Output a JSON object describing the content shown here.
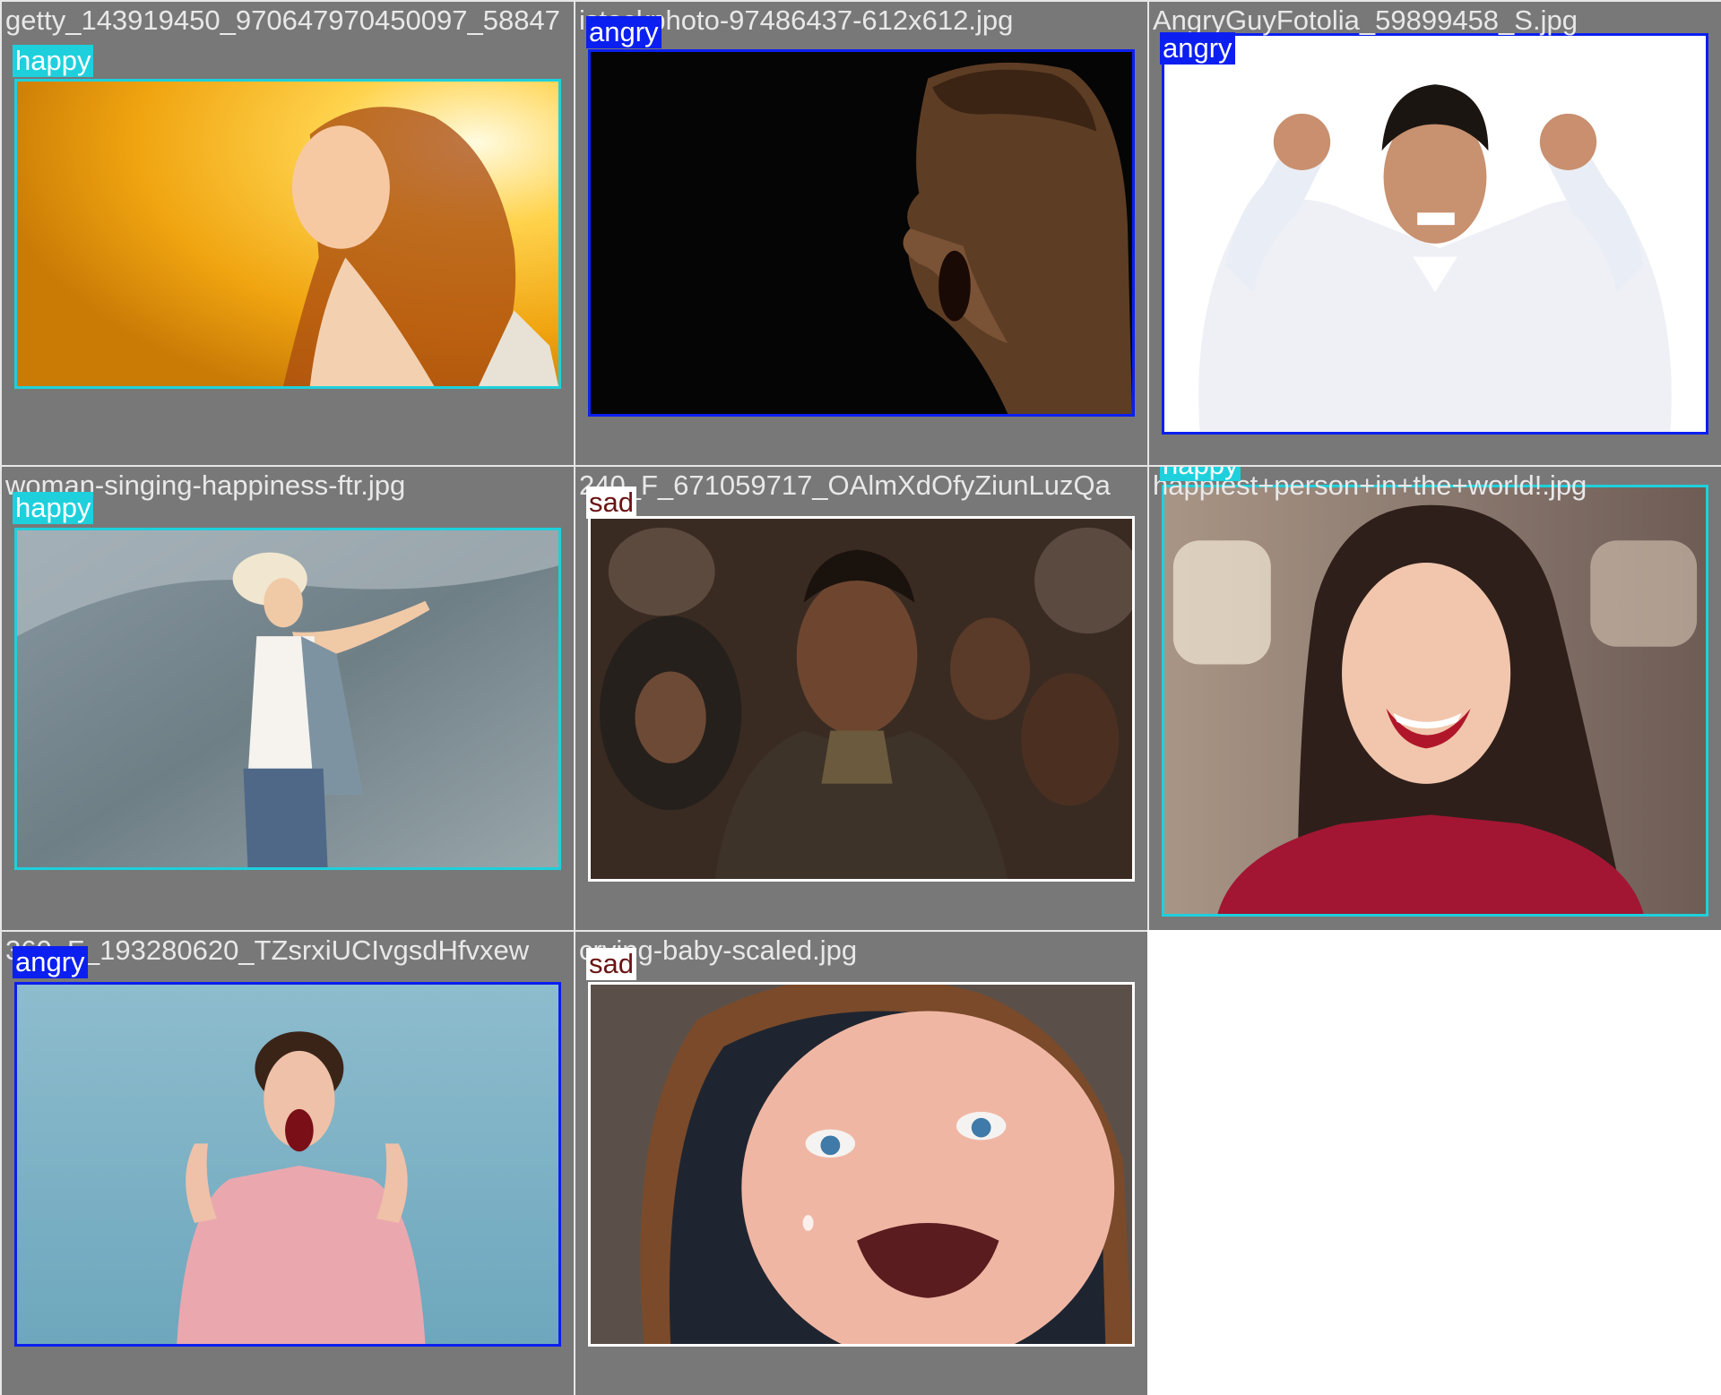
{
  "colors": {
    "happy": "#1ed0dc",
    "angry": "#0b1ff0",
    "sad": "#ffffff",
    "sad_text": "#6b1414",
    "tile_bg": "#787878"
  },
  "tiles": [
    {
      "filename": "getty_143919450_970647970450097_58847",
      "label": "happy",
      "icon": "woman-in-sunlight-photo"
    },
    {
      "filename": "istockphoto-97486437-612x612.jpg",
      "label": "angry",
      "icon": "shouting-man-photo"
    },
    {
      "filename": "AngryGuyFotolia_59899458_S.jpg",
      "label": "angry",
      "icon": "angry-man-fists-photo"
    },
    {
      "filename": "woman-singing-happiness-ftr.jpg",
      "label": "happy",
      "icon": "woman-open-arms-photo"
    },
    {
      "filename": "240_F_671059717_OAlmXdOfyZiunLuzQa",
      "label": "sad",
      "icon": "sad-man-crowd-photo"
    },
    {
      "filename": "happiest+person+in+the+world!.jpg",
      "label": "happy",
      "icon": "laughing-woman-photo"
    },
    {
      "filename": "360_F_193280620_TZsrxiUCIvgsdHfvxew",
      "label": "angry",
      "icon": "screaming-woman-photo"
    },
    {
      "filename": "crying-baby-scaled.jpg",
      "label": "sad",
      "icon": "crying-baby-photo"
    }
  ]
}
